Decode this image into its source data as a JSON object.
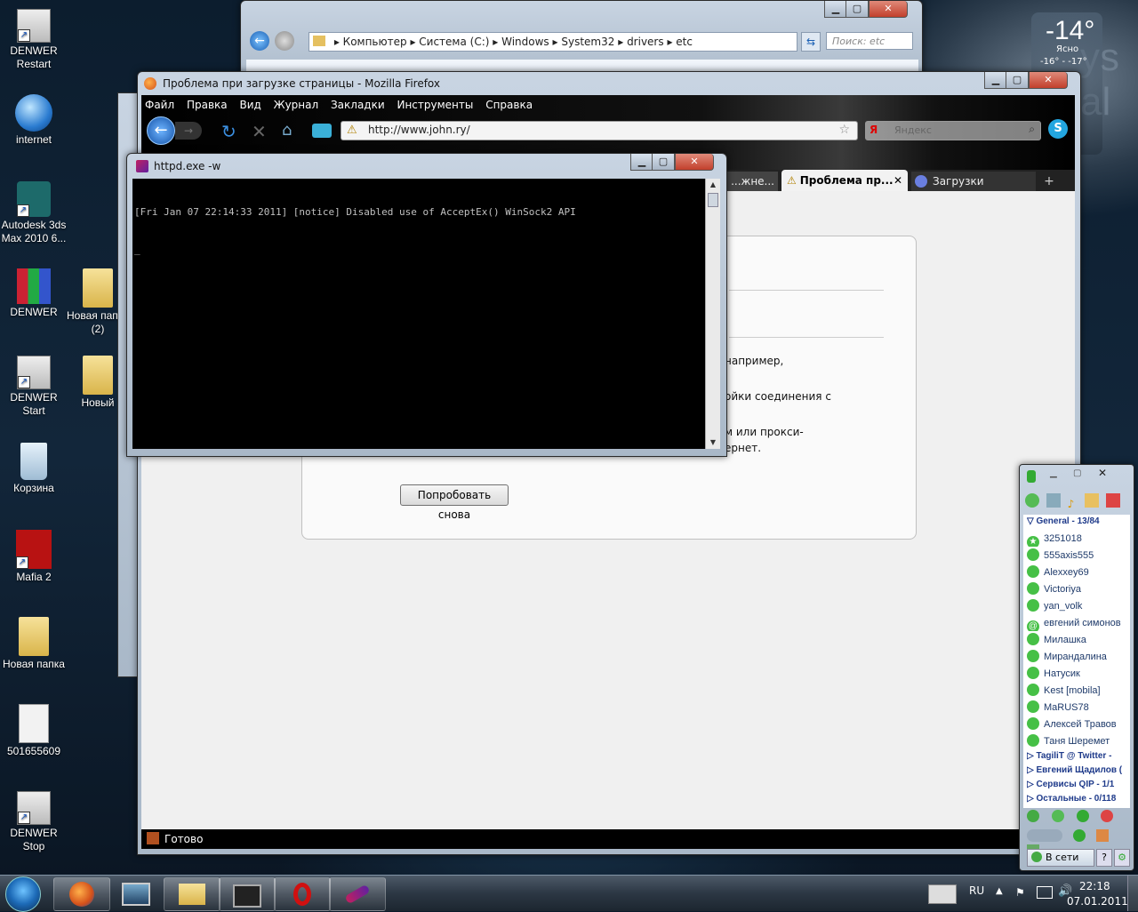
{
  "desktop": {
    "icons": [
      {
        "label": "DENWER Restart"
      },
      {
        "label": "internet"
      },
      {
        "label": "Autodesk 3ds Max 2010 6..."
      },
      {
        "label": "DENWER"
      },
      {
        "label": "Новая папка (2)"
      },
      {
        "label": "DENWER Start"
      },
      {
        "label": "Новый"
      },
      {
        "label": "Корзина"
      },
      {
        "label": "Mafia 2"
      },
      {
        "label": "Новая папка"
      },
      {
        "label": "501655609"
      },
      {
        "label": "DENWER Stop"
      }
    ]
  },
  "weather": {
    "temp": "-14°",
    "desc": "Ясно",
    "range": "-16° - -17°"
  },
  "explorer": {
    "breadcrumb": [
      "Компьютер",
      "Система (C:)",
      "Windows",
      "System32",
      "drivers",
      "etc"
    ],
    "search_placeholder": "Поиск: etc"
  },
  "firefox": {
    "title": "Проблема при загрузке страницы - Mozilla Firefox",
    "menu": [
      "Файл",
      "Правка",
      "Вид",
      "Журнал",
      "Закладки",
      "Инструменты",
      "Справка"
    ],
    "url": "http://www.john.ry/",
    "search_placeholder": "Яндекс",
    "tabs": [
      "...жне...",
      "Проблема пр...",
      "Загрузки"
    ],
    "content_fragments": [
      "например,",
      "ойки соединения с",
      "м или прокси-",
      "ернет."
    ],
    "retry_button": "Попробовать снова",
    "status": "Готово"
  },
  "console": {
    "title": "httpd.exe -w",
    "line1": "[Fri Jan 07 22:14:33 2011] [notice] Disabled use of AcceptEx() WinSock2 API",
    "cursor": "_"
  },
  "qip": {
    "group_header": "General - 13/84",
    "contacts": [
      "3251018",
      "555axis555",
      "Alexxey69",
      "Victoriya",
      "yan_volk",
      "евгений симонов",
      "Милашка",
      "Мирандалина",
      "Натусик",
      "Kest [mobila]",
      "MaRUS78",
      "Алексей Травов",
      "Таня Шеремет"
    ],
    "groups": [
      "TagiliT @ Twitter -",
      "Евгений Щадилов (",
      "Сервисы QIP - 1/1",
      "Остальные - 0/118"
    ],
    "status_label": "В сети"
  },
  "tray": {
    "lang": "RU",
    "time": "22:18",
    "date": "07.01.2011"
  }
}
